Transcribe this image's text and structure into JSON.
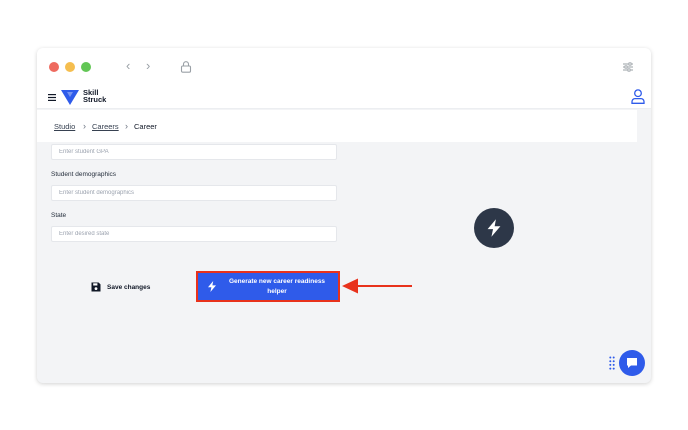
{
  "browser": {
    "traffic_lights": [
      "close",
      "minimize",
      "maximize"
    ],
    "back_glyph": "‹",
    "forward_glyph": "›"
  },
  "app": {
    "logo_text_line1": "Skill",
    "logo_text_line2": "Struck",
    "logo_color": "#2f5bea"
  },
  "breadcrumb": {
    "items": [
      "Studio",
      "Careers",
      "Career"
    ],
    "separator": "›"
  },
  "form": {
    "gpa": {
      "label": "",
      "placeholder": "Enter student GPA",
      "value": ""
    },
    "demographics": {
      "label": "Student demographics",
      "placeholder": "Enter student demographics",
      "value": ""
    },
    "state": {
      "label": "State",
      "placeholder": "Enter desired state",
      "value": ""
    }
  },
  "actions": {
    "save_label": "Save changes",
    "generate_label": "Generate new career readiness helper"
  },
  "colors": {
    "accent": "#2f5bea",
    "highlight": "#e8321c",
    "dark_circle": "#2d3748"
  },
  "icons": {
    "menu": "hamburger-icon",
    "user": "user-icon",
    "save": "floppy-disk-icon",
    "generate": "lightning-bolt-icon",
    "chat": "chat-bubble-icon"
  }
}
